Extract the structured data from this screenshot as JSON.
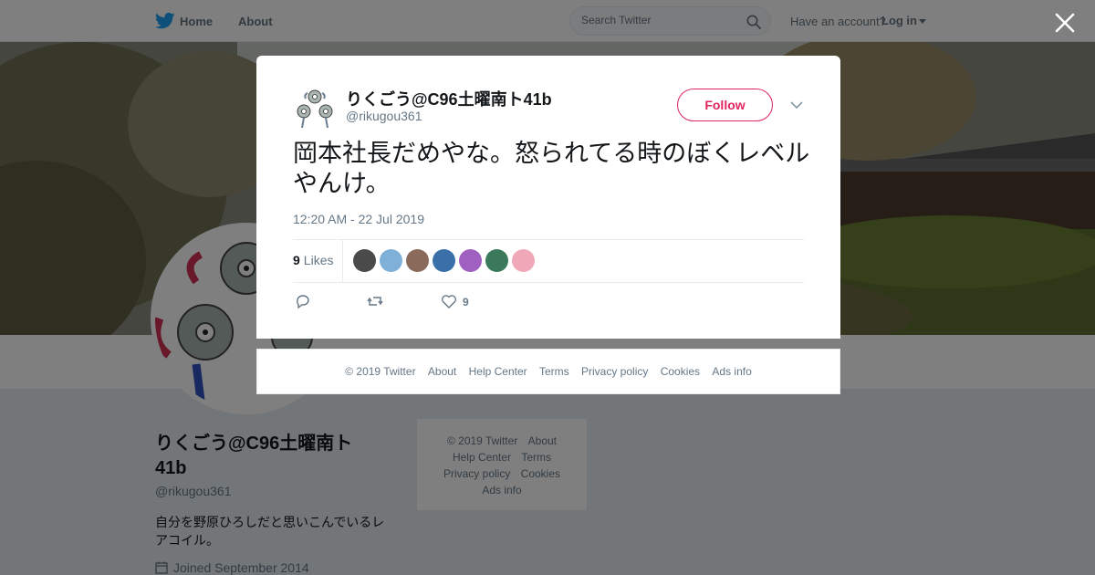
{
  "nav": {
    "home": "Home",
    "about": "About",
    "search_placeholder": "Search Twitter",
    "have_account": "Have an account?",
    "login": "Log in"
  },
  "profile": {
    "name": "りくごう@C96土曜南ト41b",
    "handle": "@rikugou361",
    "bio": "自分を野原ひろしだと思いこんでいるレアコイル。",
    "joined": "Joined September 2014"
  },
  "side_footer": {
    "copyright": "© 2019 Twitter",
    "about": "About",
    "help": "Help Center",
    "terms": "Terms",
    "privacy": "Privacy policy",
    "cookies": "Cookies",
    "ads": "Ads info"
  },
  "tweet": {
    "author_name": "りくごう@C96土曜南ト41b",
    "author_handle": "@rikugou361",
    "follow_label": "Follow",
    "text": "岡本社長だめやな。怒られてる時のぼくレベルやんけ。",
    "timestamp": "12:20 AM - 22 Jul 2019",
    "likes_count": "9",
    "likes_label": "Likes",
    "like_action_count": "9",
    "liker_colors": [
      "#4a4a4a",
      "#7fb0d8",
      "#8a6a5a",
      "#3a6fa8",
      "#a060c0",
      "#3a7a5a",
      "#f0a8b8"
    ]
  },
  "modal_footer": {
    "copyright": "© 2019 Twitter",
    "about": "About",
    "help": "Help Center",
    "terms": "Terms",
    "privacy": "Privacy policy",
    "cookies": "Cookies",
    "ads": "Ads info"
  },
  "colors": {
    "twitter_blue": "#1da1f2",
    "follow_red": "#e0245e",
    "text_gray": "#657786"
  }
}
